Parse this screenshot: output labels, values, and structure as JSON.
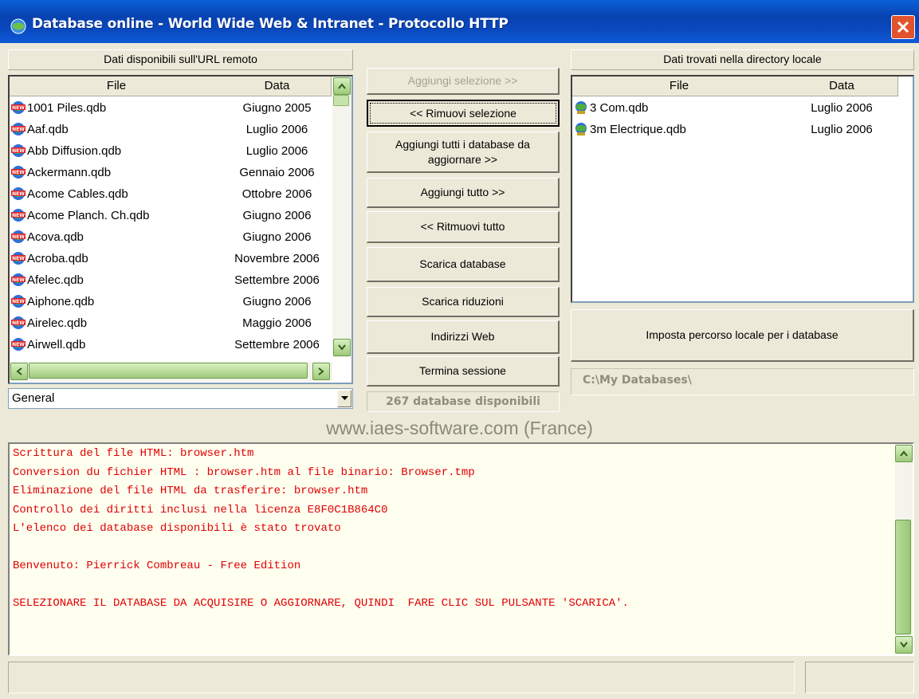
{
  "window": {
    "title": "Database online - World Wide Web & Intranet - Protocollo HTTP"
  },
  "remote_panel": {
    "header": "Dati disponibili sull'URL remoto",
    "columns": [
      "File",
      "Data"
    ],
    "rows": [
      {
        "file": "1001 Piles.qdb",
        "date": "Giugno 2005"
      },
      {
        "file": "Aaf.qdb",
        "date": "Luglio 2006"
      },
      {
        "file": "Abb Diffusion.qdb",
        "date": "Luglio 2006"
      },
      {
        "file": "Ackermann.qdb",
        "date": "Gennaio 2006"
      },
      {
        "file": "Acome Cables.qdb",
        "date": "Ottobre 2006"
      },
      {
        "file": "Acome Planch. Ch.qdb",
        "date": "Giugno 2006"
      },
      {
        "file": "Acova.qdb",
        "date": "Giugno 2006"
      },
      {
        "file": "Acroba.qdb",
        "date": "Novembre 2006"
      },
      {
        "file": "Afelec.qdb",
        "date": "Settembre 2006"
      },
      {
        "file": "Aiphone.qdb",
        "date": "Giugno 2006"
      },
      {
        "file": "Airelec.qdb",
        "date": "Maggio 2006"
      },
      {
        "file": "Airwell.qdb",
        "date": "Settembre 2006"
      }
    ],
    "category_select": "General"
  },
  "buttons": {
    "add_selection": "Aggiungi selezione >>",
    "remove_selection": "<< Rimuovi selezione",
    "add_all_update_1": "Aggiungi tutti i database da",
    "add_all_update_2": "aggiornare >>",
    "add_all": "Aggiungi tutto >>",
    "remove_all": "<< Ritmuovi tutto",
    "download_db": "Scarica database",
    "download_reductions": "Scarica riduzioni",
    "web_addresses": "Indirizzi Web",
    "end_session": "Termina sessione",
    "set_local_path": "Imposta percorso locale per i database"
  },
  "available_count": "267 database disponibili",
  "local_panel": {
    "header": "Dati trovati nella directory locale",
    "columns": [
      "File",
      "Data"
    ],
    "rows": [
      {
        "file": "3 Com.qdb",
        "date": "Luglio 2006"
      },
      {
        "file": "3m Electrique.qdb",
        "date": "Luglio 2006"
      }
    ],
    "path": "C:\\My Databases\\"
  },
  "website": "www.iaes-software.com (France)",
  "log": [
    "Scrittura del file HTML: browser.htm",
    "Conversion du fichier HTML : browser.htm al file binario: Browser.tmp",
    "Eliminazione del file HTML da trasferire: browser.htm",
    "Controllo dei diritti inclusi nella licenza E8F0C1B864C0",
    "L'elenco dei database disponibili è stato trovato",
    "",
    "Benvenuto: Pierrick Combreau - Free Edition",
    "",
    "SELEZIONARE IL DATABASE DA ACQUISIRE O AGGIORNARE, QUINDI  FARE CLIC SUL PULSANTE 'SCARICA'."
  ],
  "status_bar": {
    "left": "",
    "right": ""
  },
  "colors": {
    "log_text": "#e00000",
    "title_bar": "#0a49c0",
    "website_text": "#8a8a7a"
  }
}
